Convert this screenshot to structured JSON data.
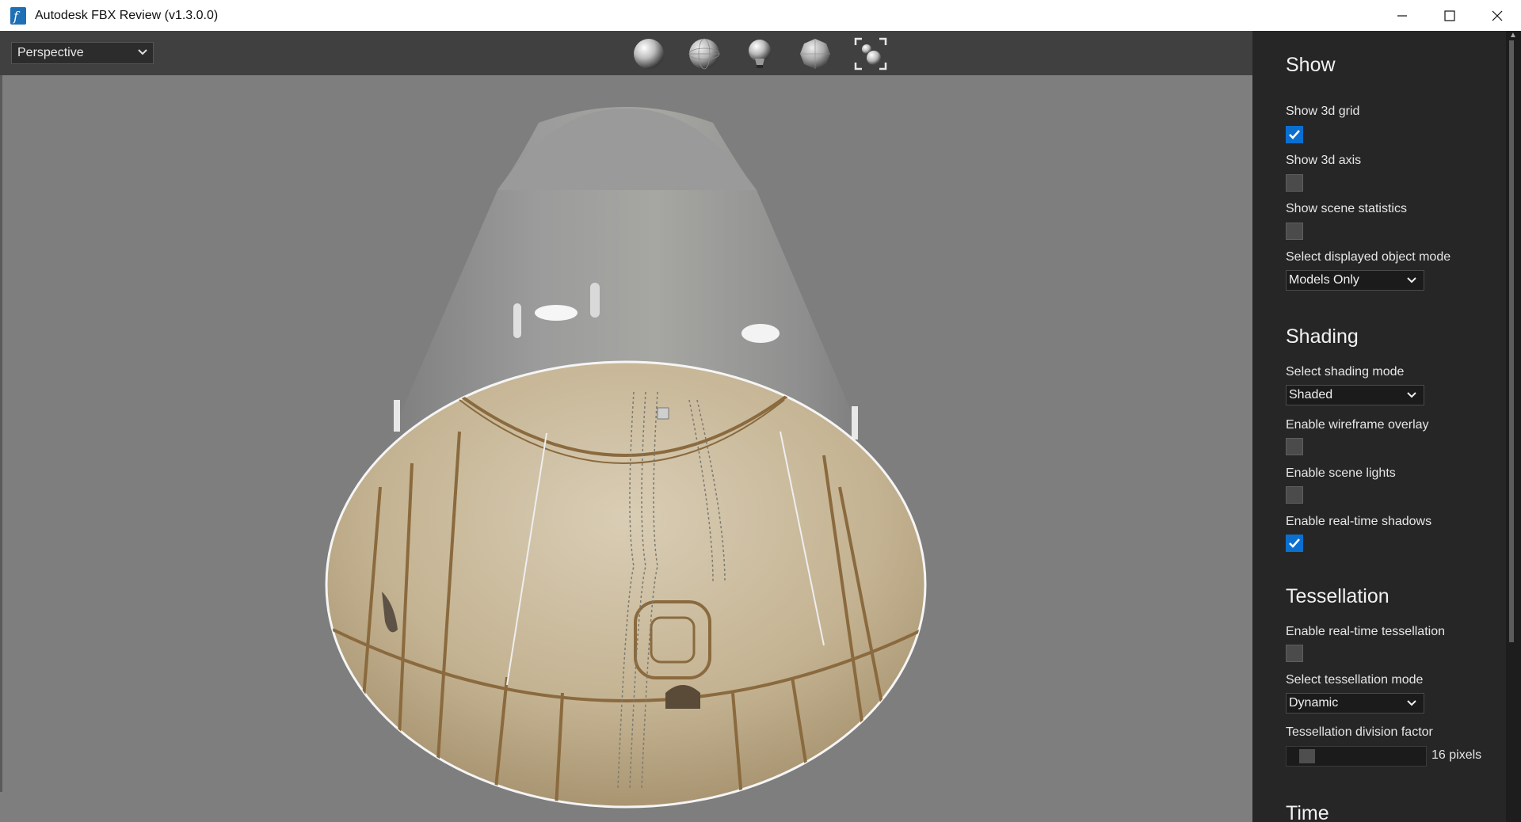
{
  "window": {
    "title": "Autodesk FBX Review (v1.3.0.0)",
    "app_icon": "autodesk-f-icon",
    "controls": [
      "minimize-icon",
      "maximize-icon",
      "close-icon"
    ]
  },
  "viewport": {
    "camera_select": "Perspective",
    "toolbar_icons": [
      "shaded-sphere-icon",
      "wireframe-sphere-icon",
      "light-bulb-icon",
      "textured-sphere-icon",
      "frame-objects-icon"
    ]
  },
  "panel": {
    "show": {
      "title": "Show",
      "grid_label": "Show 3d grid",
      "grid_checked": true,
      "axis_label": "Show 3d axis",
      "axis_checked": false,
      "stats_label": "Show scene statistics",
      "stats_checked": false,
      "object_mode_label": "Select displayed object mode",
      "object_mode_value": "Models Only"
    },
    "shading": {
      "title": "Shading",
      "mode_label": "Select shading mode",
      "mode_value": "Shaded",
      "wireframe_label": "Enable wireframe overlay",
      "wireframe_checked": false,
      "lights_label": "Enable scene lights",
      "lights_checked": false,
      "shadows_label": "Enable real-time shadows",
      "shadows_checked": true
    },
    "tessellation": {
      "title": "Tessellation",
      "enable_label": "Enable real-time tessellation",
      "enable_checked": false,
      "mode_label": "Select tessellation mode",
      "mode_value": "Dynamic",
      "factor_label": "Tessellation division factor",
      "factor_value": "16 pixels"
    },
    "time": {
      "title": "Time"
    }
  },
  "colors": {
    "viewport_bg": "#7e7e7e",
    "toolbar_bg": "#404040",
    "panel_bg": "#262626",
    "checkbox_accent": "#0b6fd0"
  }
}
